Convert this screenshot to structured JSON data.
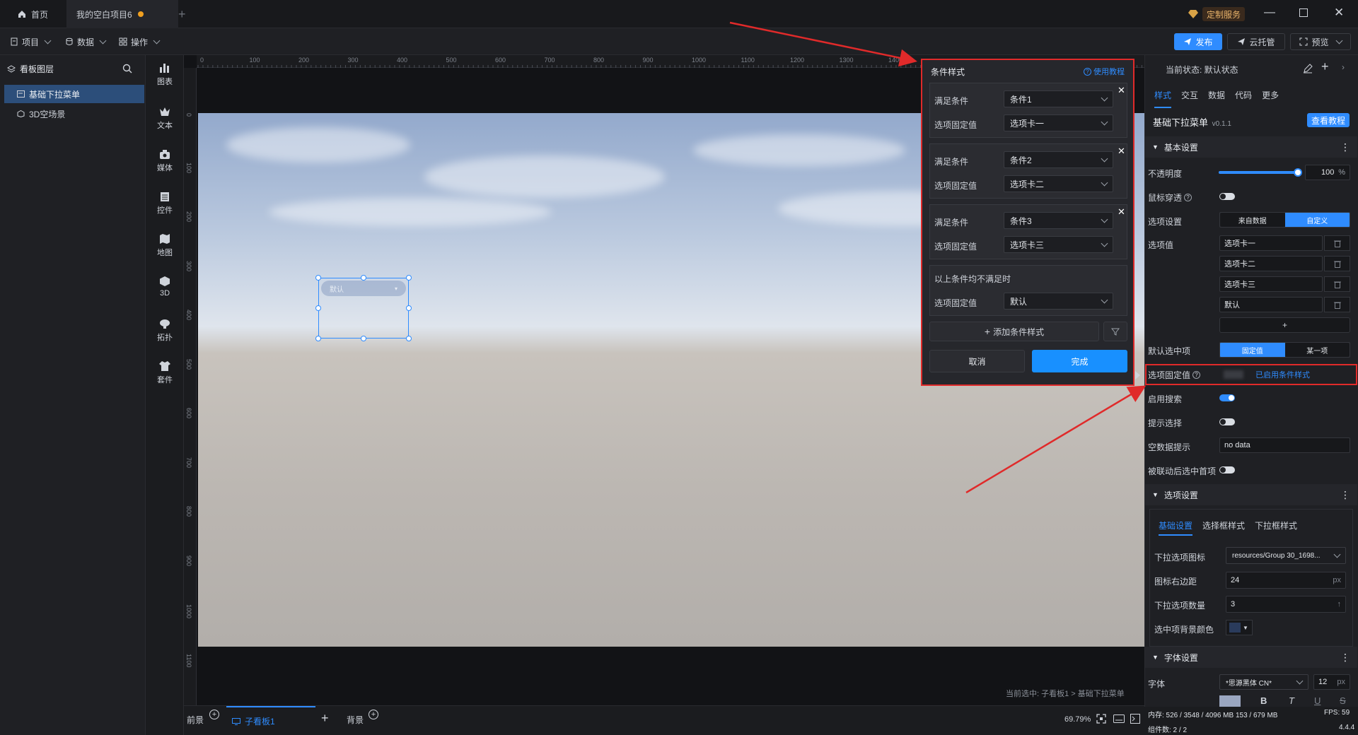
{
  "titlebar": {
    "home_tab": "首页",
    "project_tab": "我的空白项目6",
    "custom_service": "定制服务"
  },
  "menubar": {
    "project": "项目",
    "data": "数据",
    "operate": "操作",
    "publish": "发布",
    "cloud": "云托管",
    "preview": "预览"
  },
  "layers": {
    "title": "看板图层",
    "items": [
      "基础下拉菜单",
      "3D空场景"
    ]
  },
  "iconbar": [
    "图表",
    "文本",
    "媒体",
    "控件",
    "地图",
    "3D",
    "拓扑",
    "套件"
  ],
  "ruler": {
    "h_ticks": [
      "0",
      "100",
      "200",
      "300",
      "400",
      "500",
      "600",
      "700",
      "800",
      "900",
      "1000",
      "1100",
      "1200",
      "1300",
      "1400"
    ],
    "v_ticks": [
      "0",
      "100",
      "200",
      "300",
      "400",
      "500",
      "600",
      "700",
      "800",
      "900",
      "1000",
      "1100"
    ]
  },
  "canvas": {
    "dropdown_text": "默认",
    "selection_info": "当前选中: 子看板1 > 基础下拉菜单"
  },
  "popup": {
    "title": "条件样式",
    "help": "使用教程",
    "cond_label": "满足条件",
    "fixed_label": "选项固定值",
    "conditions": [
      {
        "cond": "条件1",
        "value": "选项卡一"
      },
      {
        "cond": "条件2",
        "value": "选项卡二"
      },
      {
        "cond": "条件3",
        "value": "选项卡三"
      }
    ],
    "else_label": "以上条件均不满足时",
    "else_value": "默认",
    "add": "添加条件样式",
    "cancel": "取消",
    "confirm": "完成"
  },
  "right": {
    "state_label": "当前状态:  默认状态",
    "tabs": [
      "样式",
      "交互",
      "数据",
      "代码",
      "更多"
    ],
    "component": "基础下拉菜单",
    "version": "v0.1.1",
    "tutorial": "查看教程",
    "basic_section": "基本设置",
    "opacity_label": "不透明度",
    "opacity_value": "100",
    "opacity_unit": "%",
    "opacity_level": 1.0,
    "mouse_through": "鼠标穿透",
    "option_setting": "选项设置",
    "from_data": "来自数据",
    "custom": "自定义",
    "option_value": "选项值",
    "options": [
      "选项卡一",
      "选项卡二",
      "选项卡三",
      "默认"
    ],
    "add": "+",
    "default_selected": "默认选中项",
    "fixed_value": "固定值",
    "some_item": "某一项",
    "fixed_value_label": "选项固定值",
    "condition_enabled": "已启用条件样式",
    "enable_search": "启用搜索",
    "hint_select": "提示选择",
    "empty_hint": "空数据提示",
    "empty_value": "no data",
    "linked_first": "被联动后选中首项",
    "options_section": "选项设置",
    "sub_tabs": [
      "基础设置",
      "选择框样式",
      "下拉框样式"
    ],
    "icon_label": "下拉选项图标",
    "icon_value": "resources/Group 30_1698...",
    "icon_margin_label": "图标右边距",
    "icon_margin_value": "24",
    "px": "px",
    "count_label": "下拉选项数量",
    "count_value": "3",
    "bg_color_label": "选中项背景颜色",
    "font_section": "字体设置",
    "font_label": "字体",
    "font_value": "*思源黑体 CN*",
    "font_size": "12",
    "memory": "内存:  526 / 3548 / 4096 MB  153 / 679 MB",
    "fps": "FPS:  59",
    "components": "组件数: 2 / 2",
    "version_num": "4.4.4"
  },
  "bottom": {
    "foreground": "前景",
    "sub_board": "子看板1",
    "background": "背景",
    "zoom": "69.79%"
  },
  "colors": {
    "accent": "#2f8cff",
    "annotation": "#e02a2a"
  }
}
